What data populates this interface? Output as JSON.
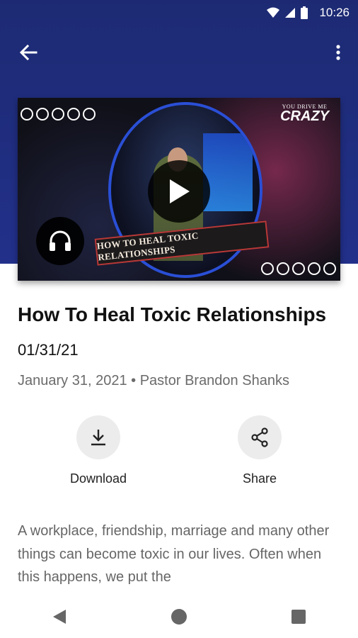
{
  "status_bar": {
    "time": "10:26"
  },
  "thumbnail": {
    "brand_small": "YOU DRIVE ME",
    "brand_big": "CRAZY",
    "strip_text": "HOW TO HEAL TOXIC RELATIONSHIPS"
  },
  "sermon": {
    "title": "How To Heal Toxic Relationships",
    "subtitle": "01/31/21",
    "date": "January 31, 2021",
    "separator": "•",
    "speaker": "Pastor Brandon Shanks",
    "description": "A workplace, friendship, marriage and many other things can become toxic in our lives. Often when this happens, we put the"
  },
  "actions": {
    "download_label": "Download",
    "share_label": "Share"
  },
  "icons": {
    "back": "arrow-back-icon",
    "more": "more-vert-icon",
    "play": "play-icon",
    "audio": "headphones-icon",
    "download": "download-icon",
    "share": "share-icon"
  },
  "colors": {
    "header": "#1d2a73",
    "action_bg": "#ececec",
    "meta_text": "#6b6b6b"
  }
}
